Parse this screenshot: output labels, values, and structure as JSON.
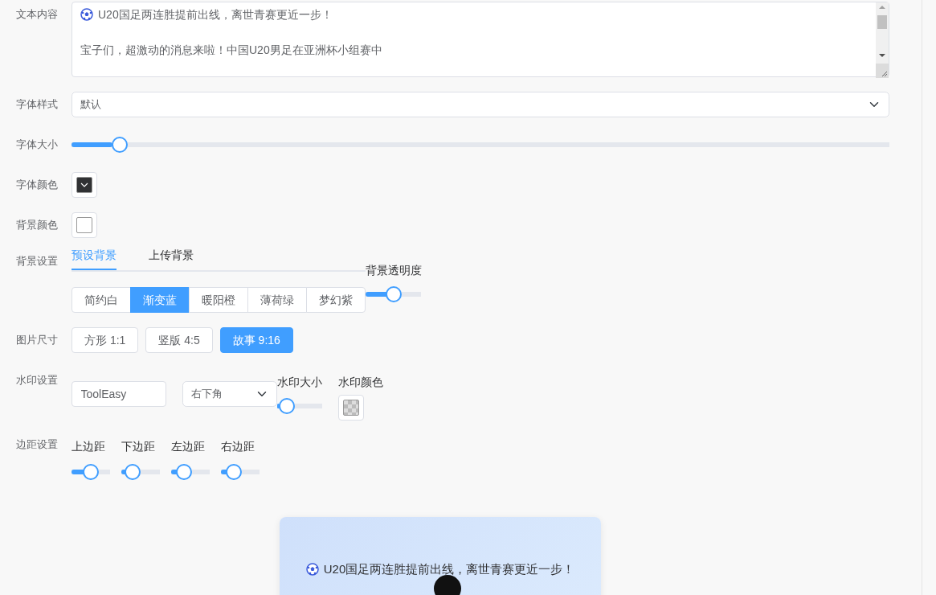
{
  "text_content": {
    "label": "文本内容",
    "paragraphs": [
      "U20国足两连胜提前出线，离世青赛更近一步！",
      "宝子们，超激动的消息来啦！中国U20男足在亚洲杯小组赛中"
    ]
  },
  "font_style": {
    "label": "字体样式",
    "value": "默认"
  },
  "font_size": {
    "label": "字体大小",
    "level": 0.05
  },
  "font_color": {
    "label": "字体颜色",
    "color": "#303133"
  },
  "background_color": {
    "label": "背景颜色",
    "color": "#ffffff"
  },
  "background_settings": {
    "label": "背景设置",
    "tabs": [
      {
        "label": "预设背景",
        "selected": true
      },
      {
        "label": "上传背景",
        "selected": false
      }
    ],
    "presets": [
      {
        "label": "简约白",
        "selected": false
      },
      {
        "label": "渐变蓝",
        "selected": true
      },
      {
        "label": "暖阳橙",
        "selected": false
      },
      {
        "label": "薄荷绿",
        "selected": false
      },
      {
        "label": "梦幻紫",
        "selected": false
      }
    ],
    "opacity": {
      "label": "背景透明度",
      "level": 0.5
    }
  },
  "image_size": {
    "label": "图片尺寸",
    "options": [
      {
        "label": "方形 1:1",
        "selected": false
      },
      {
        "label": "竖版 4:5",
        "selected": false
      },
      {
        "label": "故事 9:16",
        "selected": true
      }
    ]
  },
  "watermark": {
    "label": "水印设置",
    "text": "ToolEasy",
    "position": "右下角",
    "size": {
      "label": "水印大小",
      "level": 0.05
    },
    "color_label": "水印颜色"
  },
  "margins": {
    "label": "边距设置",
    "items": [
      {
        "label": "上边距",
        "level": 0.5
      },
      {
        "label": "下边距",
        "level": 0.15
      },
      {
        "label": "左边距",
        "level": 0.2
      },
      {
        "label": "右边距",
        "level": 0.2
      }
    ]
  },
  "preview": {
    "title": "U20国足两连胜提前出线，离世青赛更近一步！"
  }
}
